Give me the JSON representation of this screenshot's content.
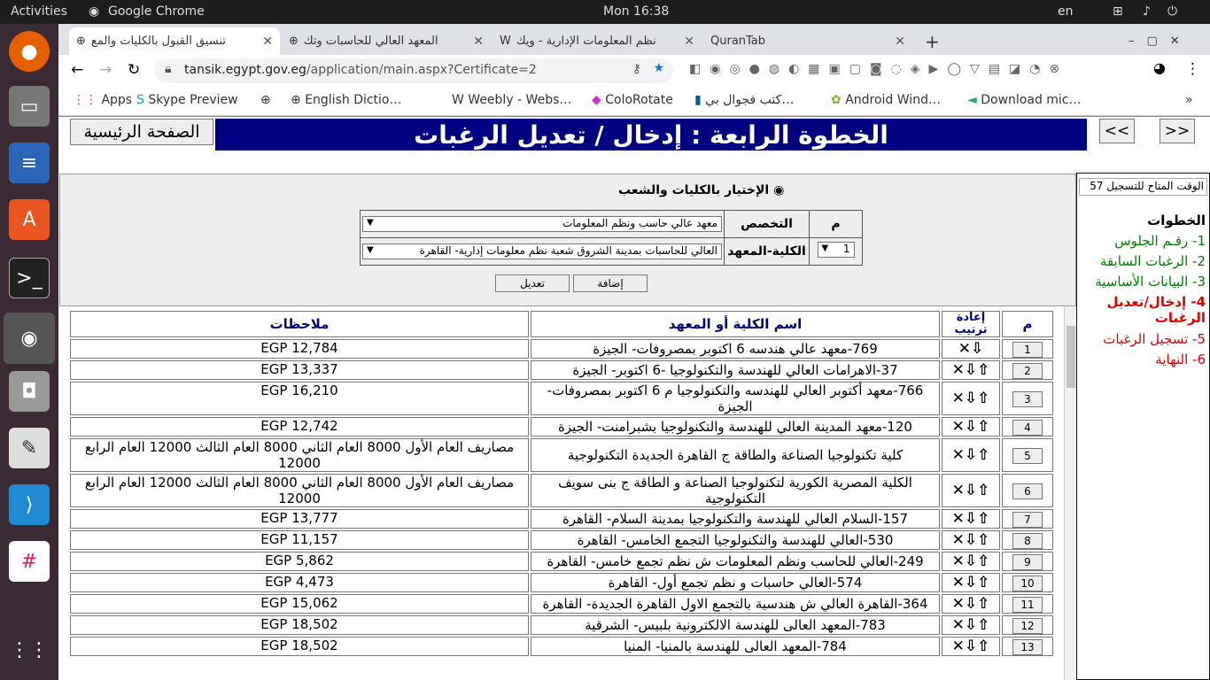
{
  "os": {
    "activities": "Activities",
    "app_name": "Google Chrome",
    "clock": "Mon 16:38",
    "language": "en"
  },
  "browser": {
    "tabs": [
      {
        "title": "تنسيق القبول بالكليات والمع",
        "active": true
      },
      {
        "title": "المعهد العالي للحاسبات وتك",
        "active": false
      },
      {
        "title": "نظم المعلومات الإدارية - ويك",
        "active": false
      },
      {
        "title": "QuranTab",
        "active": false
      }
    ],
    "new_tab": "+",
    "url_host": "tansik.egypt.gov.eg",
    "url_path": "/application/main.aspx?Certificate=2",
    "bookmarks": [
      "Apps",
      "Skype Preview",
      "English Dictio…",
      "Weebly - Webs…",
      "ColoRotate",
      "كتب فجوال بي…",
      "Android Wind…",
      "Download mic…"
    ],
    "more": "»"
  },
  "page": {
    "home_button": "الصفحة الرئيسية",
    "banner": "الخطوة الرابعة : إدخال / تعديل الرغبات",
    "prev": "<<",
    "next": ">>",
    "timer": "الوقت المتاح للتسجيل 57",
    "steps_title": "الخطوات",
    "steps": [
      {
        "label": "1- رقـم الجلوس",
        "color": "#008000"
      },
      {
        "label": "2- الرغبات السابقة",
        "color": "#008000"
      },
      {
        "label": "3- البيانات الأساسية",
        "color": "#008000"
      },
      {
        "label": "4- إدخال/تعديل الرغبات",
        "color": "#e00000"
      },
      {
        "label": "5- تسجيل الرغبات",
        "color": "#e00000"
      },
      {
        "label": "6- النهاية",
        "color": "#e00000"
      }
    ],
    "form": {
      "radio_label": "الإختيار بالكليات والشعب",
      "col_m": "م",
      "specialization_label": "التخصص",
      "specialization_value": "معهد عالي حاسب ونظم المعلومات",
      "institute_label": "الكلية-المعهد",
      "institute_value": "العالي للحاسبات بمدينة الشروق شعبة نظم معلومات إدارية- القاهرة",
      "order_value": "1",
      "add_button": "إضافة",
      "edit_button": "تعديل"
    },
    "grid": {
      "headers": {
        "m": "م",
        "reorder": "إعادة ترتيب",
        "name": "اسم الكلية أو المعهد",
        "notes": "ملاحظات"
      },
      "rows": [
        {
          "n": "1",
          "ctl": "⇩✕",
          "name": "769-معهد عالي هندسه 6 اكتوبر بمصروفات- الجيزة",
          "note": "EGP 12,784"
        },
        {
          "n": "2",
          "ctl": "⇧⇩✕",
          "name": "37-الاهرامات العالي للهندسة والتكنولوجيا -6 اكتوبر- الجيزة",
          "note": "EGP 13,337"
        },
        {
          "n": "3",
          "ctl": "⇧⇩✕",
          "name": "766-معهد أكتوبر العالي للهندسه والتكنولوجيا م 6 اكتوبر بمصروفات- الجيزة",
          "note": "EGP 16,210"
        },
        {
          "n": "4",
          "ctl": "⇧⇩✕",
          "name": "120-معهد المدينة العالي للهندسة والتكنولوجيا بشبرامنت- الجيزة",
          "note": "EGP 12,742"
        },
        {
          "n": "5",
          "ctl": "⇧⇩✕",
          "name": "كلية تكنولوجيا الصناعة والطاقة ج القاهرة الجديدة التكنولوجية",
          "note": "مصاريف العام الأول 8000 العام الثاني 8000 العام الثالث 12000 العام الرابع 12000"
        },
        {
          "n": "6",
          "ctl": "⇧⇩✕",
          "name": "الكلية المصرية الكورية لتكنولوجيا الصناعة و الطاقة ج بنى سويف التكنولوجية",
          "note": "مصاريف العام الأول 8000 العام الثاني 8000 العام الثالث 12000 العام الرابع 12000"
        },
        {
          "n": "7",
          "ctl": "⇧⇩✕",
          "name": "157-السلام العالي للهندسة والتكنولوجيا بمدينة السلام- القاهرة",
          "note": "EGP 13,777"
        },
        {
          "n": "8",
          "ctl": "⇧⇩✕",
          "name": "530-العالي للهندسة والتكنولوجيا التجمع الخامس- القاهرة",
          "note": "EGP 11,157"
        },
        {
          "n": "9",
          "ctl": "⇧⇩✕",
          "name": "249-العالي للحاسب ونظم المعلومات ش نظم تجمع خامس- القاهرة",
          "note": "EGP 5,862"
        },
        {
          "n": "10",
          "ctl": "⇧⇩✕",
          "name": "574-العالي حاسبات و نظم تجمع أول- القاهرة",
          "note": "EGP 4,473"
        },
        {
          "n": "11",
          "ctl": "⇧⇩✕",
          "name": "364-القاهرة العالي ش هندسية بالتجمع الاول القاهرة الجديدة- القاهرة",
          "note": "EGP 15,062"
        },
        {
          "n": "12",
          "ctl": "⇧⇩✕",
          "name": "783-المعهد العالى للهندسة الالكترونية بلبيس- الشرقية",
          "note": "EGP 18,502"
        },
        {
          "n": "13",
          "ctl": "⇧⇩✕",
          "name": "784-المعهد العالى للهندسة بالمنيا- المنيا",
          "note": "EGP 18,502"
        }
      ]
    }
  }
}
